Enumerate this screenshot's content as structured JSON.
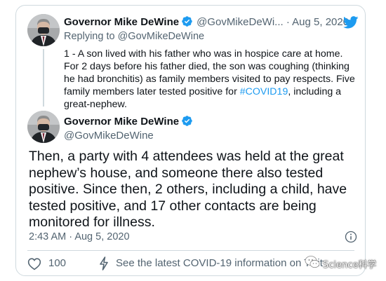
{
  "reply_tweet": {
    "name": "Governor Mike DeWine",
    "handle": "@GovMikeDeWi...",
    "separator": "·",
    "date": "Aug 5, 2020",
    "replying_prefix": "Replying to",
    "replying_to": "@GovMikeDeWine",
    "text_main": "1 - A son lived with his father who was in hospice care at home. For 2 days before his father died, the son was coughing (thinking he had bronchitis) as family members visited to pay respects. Five family members later tested positive for ",
    "hashtag": "#COVID19",
    "text_end": ", including a great-nephew."
  },
  "main_tweet": {
    "name": "Governor Mike DeWine",
    "handle": "@GovMikeDeWine",
    "text": "Then, a party with 4 attendees was held at the great nephew’s house, and someone there also tested positive.  Since then, 2 others, including a child, have tested positive, and 17 other contacts are being monitored for illness.",
    "time": "2:43 AM",
    "separator": "·",
    "date": "Aug 5, 2020"
  },
  "actions": {
    "like_count": "100",
    "covid_info_link": "See the latest COVID-19 information on Twitter"
  },
  "watermark": {
    "text": "Science科学"
  },
  "icons": {
    "verified": "verified-badge-icon",
    "twitter_bird": "twitter-bird-icon",
    "info": "info-icon",
    "like": "heart-icon",
    "covid": "lightning-bolt-icon"
  },
  "colors": {
    "accent": "#1d9bf0",
    "text": "#0f1419",
    "secondary_text": "#536471",
    "border": "#cfd9de"
  }
}
